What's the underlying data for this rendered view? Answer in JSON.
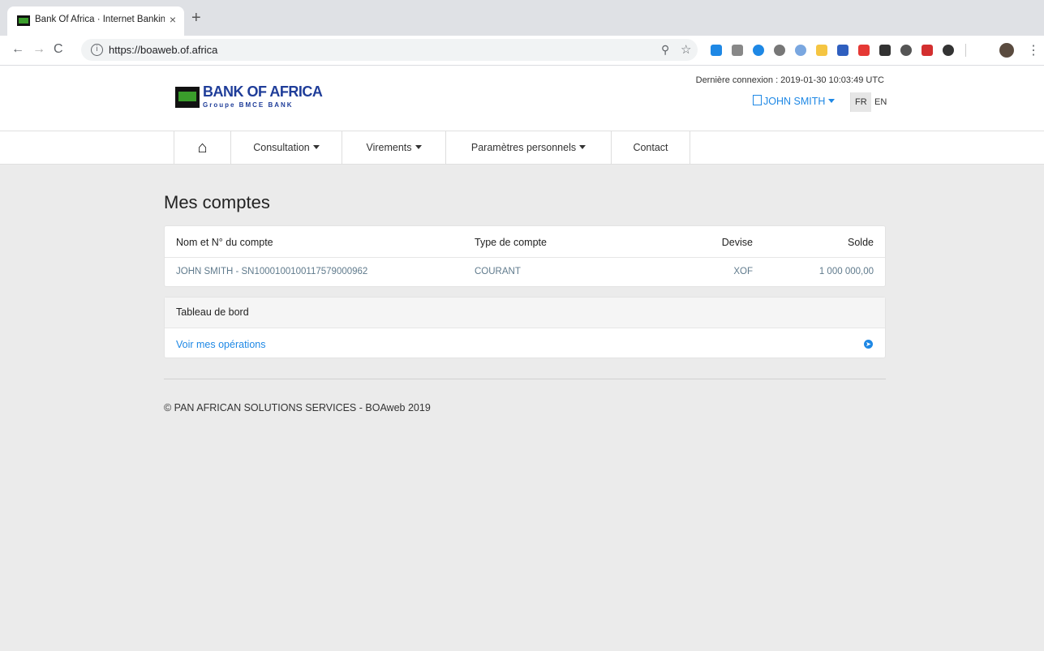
{
  "browser": {
    "tab_title": "Bank Of Africa · Internet Banking",
    "tab_close": "×",
    "new_tab": "+",
    "url_host": "https://boaweb.of.africa",
    "back": "←",
    "forward": "→",
    "reload": "C",
    "zoom_icon": "⚲",
    "star_icon": "☆",
    "menu": "⋮"
  },
  "header": {
    "logo_title": "BANK OF AFRICA",
    "logo_subtitle": "Groupe BMCE BANK",
    "last_login": "Dernière connexion : 2019-01-30 10:03:49 UTC",
    "user_name": "JOHN SMITH",
    "lang_fr": "FR",
    "lang_en": "EN"
  },
  "nav": {
    "home_glyph": "⌂",
    "consultation": "Consultation",
    "virements": "Virements",
    "parametres": "Paramètres personnels",
    "contact": "Contact"
  },
  "accounts": {
    "title": "Mes comptes",
    "headers": {
      "name": "Nom et N° du compte",
      "type": "Type de compte",
      "currency": "Devise",
      "balance": "Solde"
    },
    "rows": [
      {
        "name": "JOHN SMITH - SN1000100100117579000962",
        "type": "COURANT",
        "currency": "XOF",
        "balance": "1 000 000,00"
      }
    ]
  },
  "dashboard": {
    "title": "Tableau de bord",
    "link": "Voir mes opérations"
  },
  "footer": {
    "text": "© PAN AFRICAN SOLUTIONS SERVICES - BOAweb 2019"
  },
  "colors": {
    "brand_blue": "#1f3d99",
    "link_blue": "#1e88e5",
    "brand_green": "#3a9d2b"
  }
}
